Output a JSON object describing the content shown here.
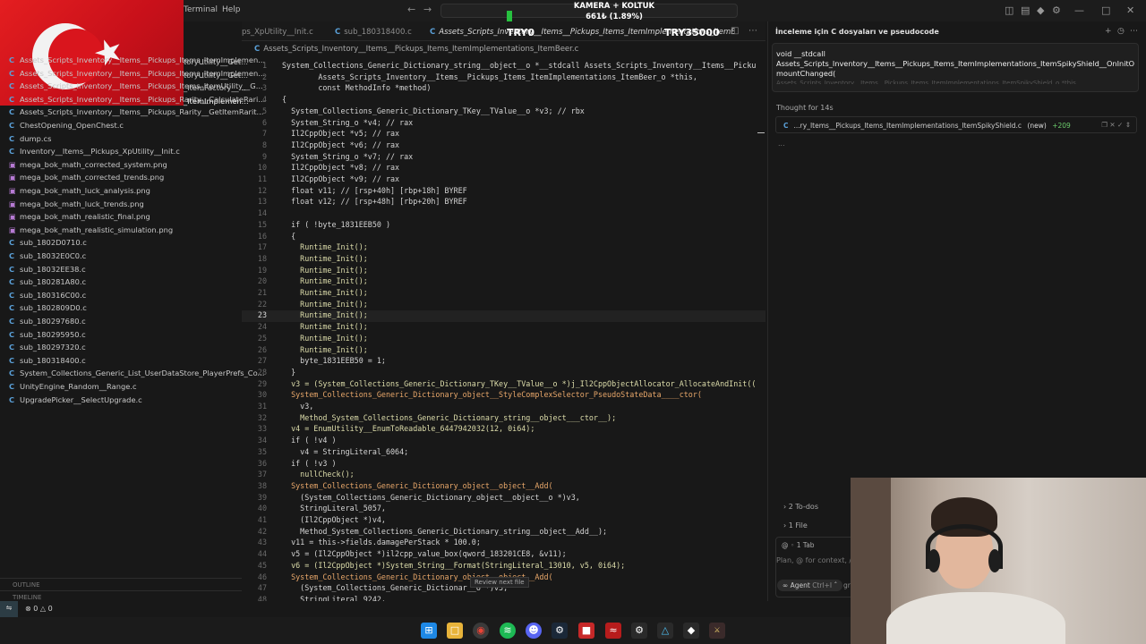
{
  "menubar": {
    "terminal": "Terminal",
    "help": "Help"
  },
  "overlay": {
    "camera": "KAMERA + KOLTUK",
    "stat": "661₺ (1.89%)",
    "try_left": "TRY0",
    "try_right": "TRY35000"
  },
  "tabs": [
    {
      "label": "ps_XpUtility__Init.c"
    },
    {
      "label": "sub_180318400.c"
    },
    {
      "label": "Assets_Scripts_Inventory__Items__Pickups_Items_ItemImplementations_ItemBeer.c"
    }
  ],
  "breadcrumb": "Assets_Scripts_Inventory__Items__Pickups_Items_ItemImplementations_ItemBeer.c",
  "sidebar_short": [
    "toryUtility__Get...",
    "toryUtility__Get...",
    "_ItemFactory__...",
    "_ItemImplemen..."
  ],
  "explorer": {
    "files": [
      {
        "name": "Assets_Scripts_Inventory__Items__Pickups_Items_ItemImplemen...",
        "type": "c"
      },
      {
        "name": "Assets_Scripts_Inventory__Items__Pickups_Items_ItemImplemen...",
        "type": "c"
      },
      {
        "name": "Assets_Scripts_Inventory__Items__Pickups_Items_ItemUtility__G...",
        "type": "c"
      },
      {
        "name": "Assets_Scripts_Inventory__Items__Pickups_Rarity__CalculateRari...",
        "type": "c"
      },
      {
        "name": "Assets_Scripts_Inventory__Items__Pickups_Rarity__GetItemRarit...",
        "type": "c"
      },
      {
        "name": "ChestOpening_OpenChest.c",
        "type": "c"
      },
      {
        "name": "dump.cs",
        "type": "c"
      },
      {
        "name": "Inventory__Items__Pickups_XpUtility__Init.c",
        "type": "c"
      },
      {
        "name": "mega_bok_math_corrected_system.png",
        "type": "img"
      },
      {
        "name": "mega_bok_math_corrected_trends.png",
        "type": "img"
      },
      {
        "name": "mega_bok_math_luck_analysis.png",
        "type": "img"
      },
      {
        "name": "mega_bok_math_luck_trends.png",
        "type": "img"
      },
      {
        "name": "mega_bok_math_realistic_final.png",
        "type": "img"
      },
      {
        "name": "mega_bok_math_realistic_simulation.png",
        "type": "img"
      },
      {
        "name": "sub_1802D0710.c",
        "type": "c"
      },
      {
        "name": "sub_18032E0C0.c",
        "type": "c"
      },
      {
        "name": "sub_18032EE38.c",
        "type": "c"
      },
      {
        "name": "sub_180281A80.c",
        "type": "c"
      },
      {
        "name": "sub_180316C00.c",
        "type": "c"
      },
      {
        "name": "sub_1802809D0.c",
        "type": "c"
      },
      {
        "name": "sub_180297680.c",
        "type": "c"
      },
      {
        "name": "sub_180295950.c",
        "type": "c"
      },
      {
        "name": "sub_180297320.c",
        "type": "c"
      },
      {
        "name": "sub_180318400.c",
        "type": "c"
      },
      {
        "name": "System_Collections_Generic_List_UserDataStore_PlayerPrefs_Co...",
        "type": "c"
      },
      {
        "name": "UnityEngine_Random__Range.c",
        "type": "c"
      },
      {
        "name": "UpgradePicker__SelectUpgrade.c",
        "type": "c"
      }
    ],
    "outline": "OUTLINE",
    "timeline": "TIMELINE"
  },
  "code": [
    {
      "n": "1",
      "t": "System_Collections_Generic_Dictionary_string__object__o *__stdcall Assets_Scripts_Inventory__Items__Picku"
    },
    {
      "n": "2",
      "t": "        Assets_Scripts_Inventory__Items__Pickups_Items_ItemImplementations_ItemBeer_o *this,"
    },
    {
      "n": "3",
      "t": "        const MethodInfo *method)"
    },
    {
      "n": "4",
      "t": "{"
    },
    {
      "n": "5",
      "t": "  System_Collections_Generic_Dictionary_TKey__TValue__o *v3; // rbx"
    },
    {
      "n": "6",
      "t": "  System_String_o *v4; // rax"
    },
    {
      "n": "7",
      "t": "  Il2CppObject *v5; // rax"
    },
    {
      "n": "8",
      "t": "  Il2CppObject *v6; // rax"
    },
    {
      "n": "9",
      "t": "  System_String_o *v7; // rax"
    },
    {
      "n": "10",
      "t": "  Il2CppObject *v8; // rax"
    },
    {
      "n": "11",
      "t": "  Il2CppObject *v9; // rax"
    },
    {
      "n": "12",
      "t": "  float v11; // [rsp+40h] [rbp+18h] BYREF"
    },
    {
      "n": "13",
      "t": "  float v12; // [rsp+48h] [rbp+20h] BYREF"
    },
    {
      "n": "14",
      "t": ""
    },
    {
      "n": "15",
      "t": "  if ( !byte_1831EEB50 )"
    },
    {
      "n": "16",
      "t": "  {"
    },
    {
      "n": "17",
      "t": "    Runtime_Init();"
    },
    {
      "n": "18",
      "t": "    Runtime_Init();"
    },
    {
      "n": "19",
      "t": "    Runtime_Init();"
    },
    {
      "n": "20",
      "t": "    Runtime_Init();"
    },
    {
      "n": "21",
      "t": "    Runtime_Init();"
    },
    {
      "n": "22",
      "t": "    Runtime_Init();"
    },
    {
      "n": "23",
      "t": "    Runtime_Init();"
    },
    {
      "n": "24",
      "t": "    Runtime_Init();"
    },
    {
      "n": "25",
      "t": "    Runtime_Init();"
    },
    {
      "n": "26",
      "t": "    Runtime_Init();"
    },
    {
      "n": "27",
      "t": "    byte_1831EEB50 = 1;"
    },
    {
      "n": "28",
      "t": "  }"
    },
    {
      "n": "29",
      "t": "  v3 = (System_Collections_Generic_Dictionary_TKey__TValue__o *)j_Il2CppObjectAllocator_AllocateAndInit(("
    },
    {
      "n": "30",
      "t": "  System_Collections_Generic_Dictionary_object__StyleComplexSelector_PseudoStateData____ctor("
    },
    {
      "n": "31",
      "t": "    v3,"
    },
    {
      "n": "32",
      "t": "    Method_System_Collections_Generic_Dictionary_string__object___ctor__);"
    },
    {
      "n": "33",
      "t": "  v4 = EnumUtility__EnumToReadable_6447942032(12, 0i64);"
    },
    {
      "n": "34",
      "t": "  if ( !v4 )"
    },
    {
      "n": "35",
      "t": "    v4 = StringLiteral_6064;"
    },
    {
      "n": "36",
      "t": "  if ( !v3 )"
    },
    {
      "n": "37",
      "t": "    nullCheck();"
    },
    {
      "n": "38",
      "t": "  System_Collections_Generic_Dictionary_object__object__Add("
    },
    {
      "n": "39",
      "t": "    (System_Collections_Generic_Dictionary_object__object__o *)v3,"
    },
    {
      "n": "40",
      "t": "    StringLiteral_5057,"
    },
    {
      "n": "41",
      "t": "    (Il2CppObject *)v4,"
    },
    {
      "n": "42",
      "t": "    Method_System_Collections_Generic_Dictionary_string__object__Add__);"
    },
    {
      "n": "43",
      "t": "  v11 = this->fields.damagePerStack * 100.0;"
    },
    {
      "n": "44",
      "t": "  v5 = (Il2CppObject *)il2cpp_value_box(qword_183201CE8, &v11);"
    },
    {
      "n": "45",
      "t": "  v6 = (Il2CppObject *)System_String__Format(StringLiteral_13010, v5, 0i64);"
    },
    {
      "n": "46",
      "t": "  System_Collections_Generic_Dictionary_object__object__Add("
    },
    {
      "n": "47",
      "t": "    (System_Collections_Generic_Dictionar__o *)v3,"
    },
    {
      "n": "48",
      "t": "    StringLiteral_9242,"
    }
  ],
  "tooltip": "Review next file",
  "chat": {
    "title": "İnceleme için C dosyaları ve pseudocode",
    "message_line1": "void __stdcall",
    "message_line2": "Assets_Scripts_Inventory__Items__Pickups_Items_ItemImplementations_ItemSpikyShield__OnInitOrA",
    "message_line3": "mountChanged(",
    "message_line4": "Assets_Scripts_Inventory__Items__Pickups_Items_ItemImplementations_ItemSpikyShield_o *this,",
    "thought": "Thought for 14s",
    "file_chip": "...ry_Items__Pickups_Items_ItemImplementations_ItemSpikyShield.c",
    "file_new": "(new)",
    "file_added": "+209",
    "dots": "...",
    "todos": "2 To-dos",
    "files": "1 File",
    "tab": "1 Tab",
    "placeholder": "Plan, @ for context, /",
    "agent": "Agent",
    "agent_shortcut": "Ctrl+I",
    "grey": "gr"
  },
  "status": {
    "errors": "0",
    "warnings": "0"
  },
  "colors": {
    "accent": "#5aa0d8",
    "flag_red": "#e41e20",
    "green": "#6ccc6c"
  }
}
